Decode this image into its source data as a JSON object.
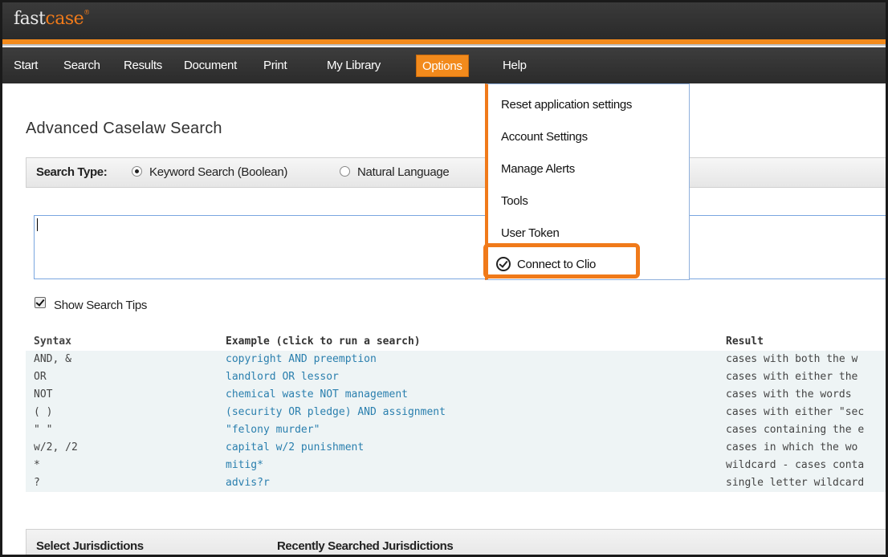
{
  "brand": {
    "logo_main": "fast",
    "logo_accent": "case",
    "logo_mark": "®"
  },
  "nav": {
    "items": [
      "Start",
      "Search",
      "Results",
      "Document",
      "Print",
      "My Library",
      "Options",
      "Help"
    ],
    "active": "Options"
  },
  "options_menu": {
    "items": [
      "Reset application settings",
      "Account Settings",
      "Manage Alerts",
      "Tools",
      "User Token",
      "Connect to Clio"
    ],
    "highlighted": "Connect to Clio",
    "highlight_color": "#f07a1a",
    "clio_icon": "check-circle-icon"
  },
  "page": {
    "title": "Advanced Caselaw Search"
  },
  "search_type": {
    "label": "Search Type:",
    "options": [
      "Keyword Search (Boolean)",
      "Natural Language"
    ],
    "selected": "Keyword Search (Boolean)"
  },
  "query": {
    "value": ""
  },
  "tips": {
    "show_label": "Show Search Tips",
    "checked": true,
    "headers": [
      "Syntax",
      "Example (click to run a search)",
      "Result"
    ],
    "rows": [
      {
        "syntax": "AND, &",
        "example": "copyright AND preemption",
        "result": "cases with both the w"
      },
      {
        "syntax": "OR",
        "example": "landlord OR lessor",
        "result": "cases with either the"
      },
      {
        "syntax": "NOT",
        "example": "chemical waste NOT management",
        "result": "cases with the words"
      },
      {
        "syntax": "( )",
        "example": "(security OR pledge) AND assignment",
        "result": "cases with either \"sec"
      },
      {
        "syntax": "\" \"",
        "example": "\"felony murder\"",
        "result": "cases containing the e"
      },
      {
        "syntax": "w/2, /2",
        "example": "capital w/2 punishment",
        "result": "cases in which the wo"
      },
      {
        "syntax": "*",
        "example": "mitig*",
        "result": "wildcard - cases conta"
      },
      {
        "syntax": "?",
        "example": "advis?r",
        "result": "single letter wildcard"
      }
    ]
  },
  "jurisdictions": {
    "select_label": "Select Jurisdictions",
    "recent_label": "Recently Searched Jurisdictions"
  },
  "colors": {
    "brand_orange": "#f38a1b",
    "link_blue": "#2a7fae",
    "nav_dark": "#2b2b2b"
  }
}
